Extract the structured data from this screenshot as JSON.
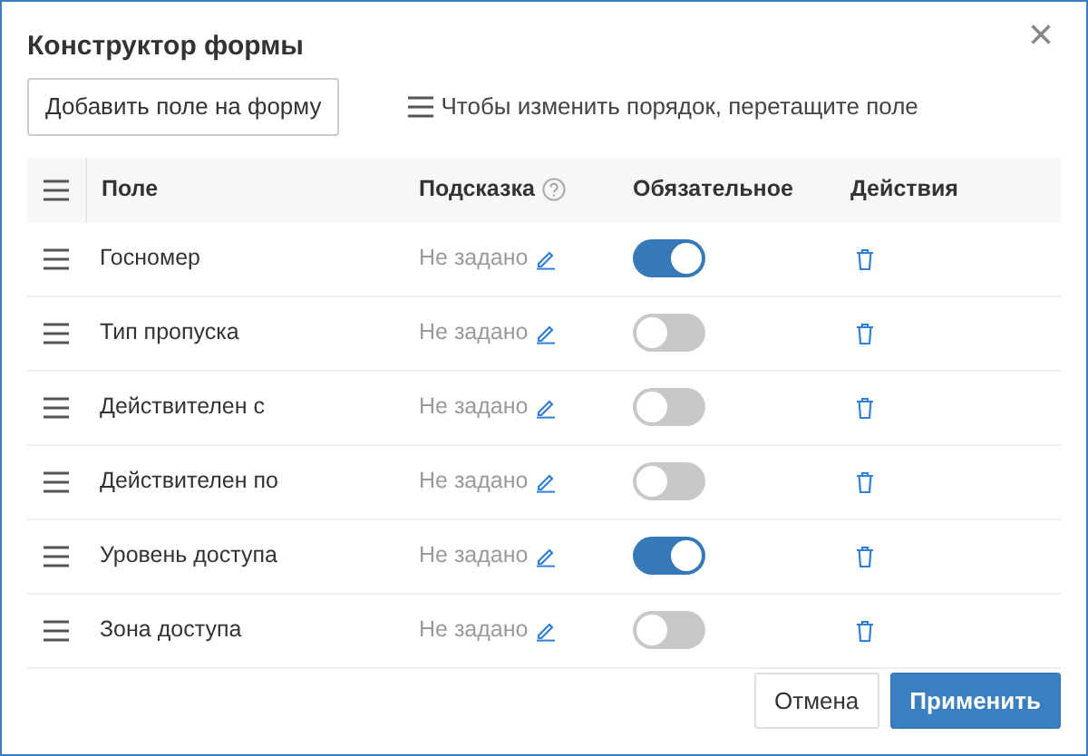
{
  "dialog": {
    "title": "Конструктор формы",
    "close": "×"
  },
  "toolbar": {
    "add_button": "Добавить поле на форму",
    "hint": "Чтобы изменить порядок, перетащите поле"
  },
  "table": {
    "columns": [
      "Поле",
      "Подсказка",
      "Обязательное",
      "Действия"
    ],
    "rows": [
      {
        "field": "Госномер",
        "hint": "Не задано",
        "required": true
      },
      {
        "field": "Тип пропуска",
        "hint": "Не задано",
        "required": false
      },
      {
        "field": "Действителен с",
        "hint": "Не задано",
        "required": false
      },
      {
        "field": "Действителен по",
        "hint": "Не задано",
        "required": false
      },
      {
        "field": "Уровень доступа",
        "hint": "Не задано",
        "required": true
      },
      {
        "field": "Зона доступа",
        "hint": "Не задано",
        "required": false
      }
    ]
  },
  "buttons": [
    {
      "label": "Отмена",
      "kind": "secondary"
    },
    {
      "label": "Применить",
      "kind": "primary"
    }
  ]
}
